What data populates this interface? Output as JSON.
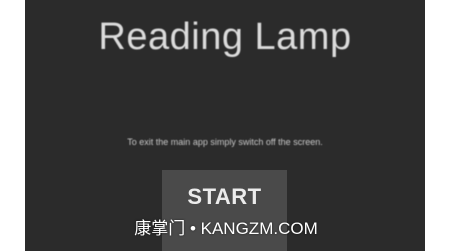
{
  "app": {
    "title": "Reading Lamp",
    "instructions": "To exit the main app simply switch off the screen.",
    "start_label": "START"
  },
  "watermark": {
    "text": "康掌门 • KANGZM.COM"
  },
  "colors": {
    "background": "#2b2b2b",
    "button": "#4a4a4a",
    "text": "#dcdcdc"
  }
}
